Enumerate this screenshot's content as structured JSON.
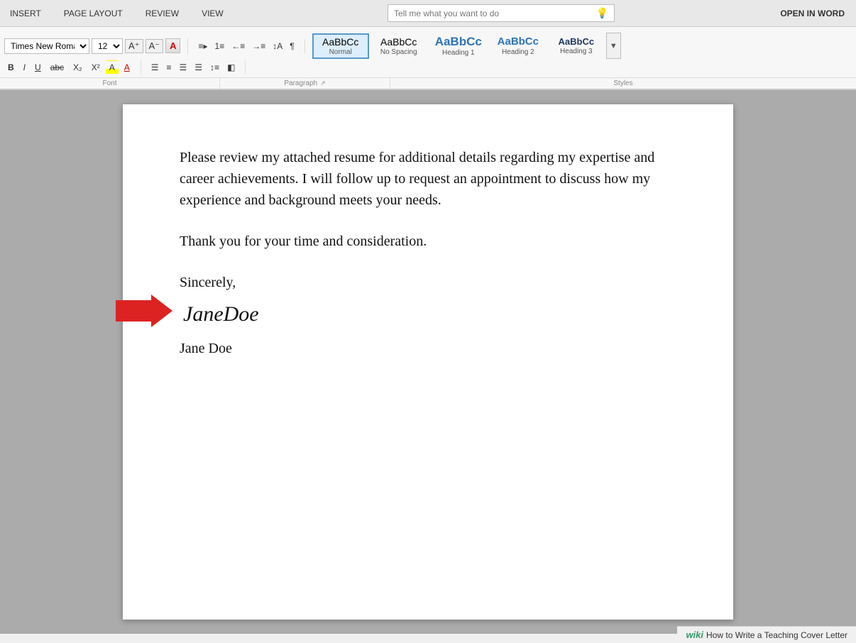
{
  "menu": {
    "items": [
      "INSERT",
      "PAGE LAYOUT",
      "REVIEW",
      "VIEW"
    ],
    "search_placeholder": "Tell me what you want to do",
    "search_icon": "💡",
    "open_in_word": "OPEN IN WORD"
  },
  "ribbon": {
    "font_name": "Times New Roman",
    "font_size": "12",
    "section_labels": {
      "font": "Font",
      "paragraph": "Paragraph",
      "styles": "Styles"
    },
    "format_buttons": [
      "B",
      "I",
      "U",
      "abc",
      "X₂",
      "X²",
      "A"
    ],
    "para_icons": [
      "≡",
      "≡",
      "←",
      "→",
      "¶",
      "⟷"
    ],
    "para_icons2": [
      "≡",
      "≡",
      "≡",
      "≡",
      "↕",
      "↔"
    ],
    "styles": [
      {
        "label": "Normal",
        "preview": "AaBbCc",
        "active": true
      },
      {
        "label": "No Spacing",
        "preview": "AaBbCc",
        "active": false
      },
      {
        "label": "Heading 1",
        "preview": "AaBbCc",
        "active": false
      },
      {
        "label": "Heading 2",
        "preview": "AaBbCc",
        "active": false
      },
      {
        "label": "Heading 3",
        "preview": "AaBbCc",
        "active": false
      }
    ]
  },
  "document": {
    "paragraphs": [
      "Please review my attached resume for additional details regarding my expertise and career achievements. I will follow up to request an appointment to discuss how my experience and background meets your needs.",
      "Thank you for your time and consideration.",
      "Sincerely,"
    ],
    "signature_cursive": "JaneDoe",
    "signature_name": "Jane Doe"
  },
  "footer": {
    "wiki_label": "wiki",
    "page_title": "How to Write a Teaching Cover Letter"
  }
}
